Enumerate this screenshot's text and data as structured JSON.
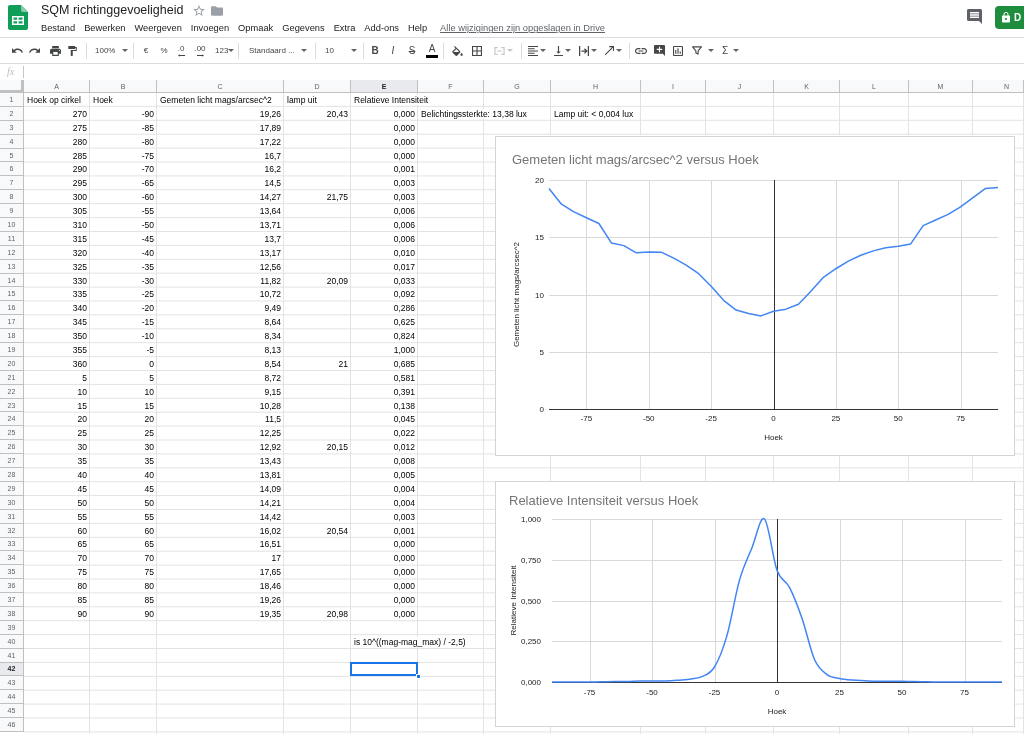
{
  "document": {
    "title": "SQM richtinggevoeligheid",
    "starred": false
  },
  "menu": [
    "Bestand",
    "Bewerken",
    "Weergeven",
    "Invoegen",
    "Opmaak",
    "Gegevens",
    "Extra",
    "Add-ons",
    "Help"
  ],
  "save_status": "Alle wijzigingen zijn opgeslagen in Drive",
  "share_button": "D",
  "toolbar": {
    "zoom": "100%",
    "currency": "€",
    "percent": "%",
    "decimals_less": ".0",
    "decimals_more": ".00",
    "number_format": "123",
    "font": "Standaard ...",
    "font_size": "10",
    "bold": "B",
    "italic": "I",
    "strikethrough": "S",
    "text_color": "A",
    "merge_disabled": true,
    "functions": "Σ"
  },
  "formula_bar": {
    "label": "fx"
  },
  "sheet": {
    "columns": [
      {
        "label": "A",
        "selected": false
      },
      {
        "label": "B",
        "selected": false
      },
      {
        "label": "C",
        "selected": false
      },
      {
        "label": "D",
        "selected": false
      },
      {
        "label": "E",
        "selected": true
      },
      {
        "label": "F",
        "selected": false
      },
      {
        "label": "G",
        "selected": false
      },
      {
        "label": "H",
        "selected": false
      },
      {
        "label": "I",
        "selected": false
      },
      {
        "label": "J",
        "selected": false
      },
      {
        "label": "K",
        "selected": false
      },
      {
        "label": "L",
        "selected": false
      },
      {
        "label": "M",
        "selected": false
      },
      {
        "label": "N",
        "selected": false
      }
    ],
    "rows": [
      {
        "number": "1",
        "selected": false,
        "cells": [
          {
            "text": "Hoek op cirkel",
            "kind": "text"
          },
          {
            "text": "Hoek",
            "kind": "text"
          },
          {
            "text": "Gemeten licht mags/arcsec^2",
            "kind": "text"
          },
          {
            "text": "lamp uit",
            "kind": "text"
          },
          {
            "text": "Relatieve Intensiteit",
            "kind": "text"
          }
        ]
      },
      {
        "number": "2",
        "selected": false,
        "cells": [
          {
            "text": "270",
            "kind": "number"
          },
          {
            "text": "-90",
            "kind": "number"
          },
          {
            "text": "19,26",
            "kind": "number"
          },
          {
            "text": "20,43",
            "kind": "number"
          },
          {
            "text": "0,000",
            "kind": "number"
          },
          {
            "text": "Belichtingssterkte: 13,38 lux",
            "kind": "text"
          },
          null,
          {
            "text": "Lamp uit: < 0,004 lux",
            "kind": "text"
          }
        ]
      },
      {
        "number": "3",
        "selected": false,
        "cells": [
          {
            "text": "275",
            "kind": "number"
          },
          {
            "text": "-85",
            "kind": "number"
          },
          {
            "text": "17,89",
            "kind": "number"
          },
          null,
          {
            "text": "0,000",
            "kind": "number"
          }
        ]
      },
      {
        "number": "4",
        "selected": false,
        "cells": [
          {
            "text": "280",
            "kind": "number"
          },
          {
            "text": "-80",
            "kind": "number"
          },
          {
            "text": "17,22",
            "kind": "number"
          },
          null,
          {
            "text": "0,000",
            "kind": "number"
          }
        ]
      },
      {
        "number": "5",
        "selected": false,
        "cells": [
          {
            "text": "285",
            "kind": "number"
          },
          {
            "text": "-75",
            "kind": "number"
          },
          {
            "text": "16,7",
            "kind": "number"
          },
          null,
          {
            "text": "0,000",
            "kind": "number"
          }
        ]
      },
      {
        "number": "6",
        "selected": false,
        "cells": [
          {
            "text": "290",
            "kind": "number"
          },
          {
            "text": "-70",
            "kind": "number"
          },
          {
            "text": "16,2",
            "kind": "number"
          },
          null,
          {
            "text": "0,001",
            "kind": "number"
          }
        ]
      },
      {
        "number": "7",
        "selected": false,
        "cells": [
          {
            "text": "295",
            "kind": "number"
          },
          {
            "text": "-65",
            "kind": "number"
          },
          {
            "text": "14,5",
            "kind": "number"
          },
          null,
          {
            "text": "0,003",
            "kind": "number"
          }
        ]
      },
      {
        "number": "8",
        "selected": false,
        "cells": [
          {
            "text": "300",
            "kind": "number"
          },
          {
            "text": "-60",
            "kind": "number"
          },
          {
            "text": "14,27",
            "kind": "number"
          },
          {
            "text": "21,75",
            "kind": "number"
          },
          {
            "text": "0,003",
            "kind": "number"
          }
        ]
      },
      {
        "number": "9",
        "selected": false,
        "cells": [
          {
            "text": "305",
            "kind": "number"
          },
          {
            "text": "-55",
            "kind": "number"
          },
          {
            "text": "13,64",
            "kind": "number"
          },
          null,
          {
            "text": "0,006",
            "kind": "number"
          }
        ]
      },
      {
        "number": "10",
        "selected": false,
        "cells": [
          {
            "text": "310",
            "kind": "number"
          },
          {
            "text": "-50",
            "kind": "number"
          },
          {
            "text": "13,71",
            "kind": "number"
          },
          null,
          {
            "text": "0,006",
            "kind": "number"
          }
        ]
      },
      {
        "number": "11",
        "selected": false,
        "cells": [
          {
            "text": "315",
            "kind": "number"
          },
          {
            "text": "-45",
            "kind": "number"
          },
          {
            "text": "13,7",
            "kind": "number"
          },
          null,
          {
            "text": "0,006",
            "kind": "number"
          }
        ]
      },
      {
        "number": "12",
        "selected": false,
        "cells": [
          {
            "text": "320",
            "kind": "number"
          },
          {
            "text": "-40",
            "kind": "number"
          },
          {
            "text": "13,17",
            "kind": "number"
          },
          null,
          {
            "text": "0,010",
            "kind": "number"
          }
        ]
      },
      {
        "number": "13",
        "selected": false,
        "cells": [
          {
            "text": "325",
            "kind": "number"
          },
          {
            "text": "-35",
            "kind": "number"
          },
          {
            "text": "12,56",
            "kind": "number"
          },
          null,
          {
            "text": "0,017",
            "kind": "number"
          }
        ]
      },
      {
        "number": "14",
        "selected": false,
        "cells": [
          {
            "text": "330",
            "kind": "number"
          },
          {
            "text": "-30",
            "kind": "number"
          },
          {
            "text": "11,82",
            "kind": "number"
          },
          {
            "text": "20,09",
            "kind": "number"
          },
          {
            "text": "0,033",
            "kind": "number"
          }
        ]
      },
      {
        "number": "15",
        "selected": false,
        "cells": [
          {
            "text": "335",
            "kind": "number"
          },
          {
            "text": "-25",
            "kind": "number"
          },
          {
            "text": "10,72",
            "kind": "number"
          },
          null,
          {
            "text": "0,092",
            "kind": "number"
          }
        ]
      },
      {
        "number": "16",
        "selected": false,
        "cells": [
          {
            "text": "340",
            "kind": "number"
          },
          {
            "text": "-20",
            "kind": "number"
          },
          {
            "text": "9,49",
            "kind": "number"
          },
          null,
          {
            "text": "0,286",
            "kind": "number"
          }
        ]
      },
      {
        "number": "17",
        "selected": false,
        "cells": [
          {
            "text": "345",
            "kind": "number"
          },
          {
            "text": "-15",
            "kind": "number"
          },
          {
            "text": "8,64",
            "kind": "number"
          },
          null,
          {
            "text": "0,625",
            "kind": "number"
          }
        ]
      },
      {
        "number": "18",
        "selected": false,
        "cells": [
          {
            "text": "350",
            "kind": "number"
          },
          {
            "text": "-10",
            "kind": "number"
          },
          {
            "text": "8,34",
            "kind": "number"
          },
          null,
          {
            "text": "0,824",
            "kind": "number"
          }
        ]
      },
      {
        "number": "19",
        "selected": false,
        "cells": [
          {
            "text": "355",
            "kind": "number"
          },
          {
            "text": "-5",
            "kind": "number"
          },
          {
            "text": "8,13",
            "kind": "number"
          },
          null,
          {
            "text": "1,000",
            "kind": "number"
          }
        ]
      },
      {
        "number": "20",
        "selected": false,
        "cells": [
          {
            "text": "360",
            "kind": "number"
          },
          {
            "text": "0",
            "kind": "number"
          },
          {
            "text": "8,54",
            "kind": "number"
          },
          {
            "text": "21",
            "kind": "number"
          },
          {
            "text": "0,685",
            "kind": "number"
          }
        ]
      },
      {
        "number": "21",
        "selected": false,
        "cells": [
          {
            "text": "5",
            "kind": "number"
          },
          {
            "text": "5",
            "kind": "number"
          },
          {
            "text": "8,72",
            "kind": "number"
          },
          null,
          {
            "text": "0,581",
            "kind": "number"
          }
        ]
      },
      {
        "number": "22",
        "selected": false,
        "cells": [
          {
            "text": "10",
            "kind": "number"
          },
          {
            "text": "10",
            "kind": "number"
          },
          {
            "text": "9,15",
            "kind": "number"
          },
          null,
          {
            "text": "0,391",
            "kind": "number"
          }
        ]
      },
      {
        "number": "23",
        "selected": false,
        "cells": [
          {
            "text": "15",
            "kind": "number"
          },
          {
            "text": "15",
            "kind": "number"
          },
          {
            "text": "10,28",
            "kind": "number"
          },
          null,
          {
            "text": "0,138",
            "kind": "number"
          }
        ]
      },
      {
        "number": "24",
        "selected": false,
        "cells": [
          {
            "text": "20",
            "kind": "number"
          },
          {
            "text": "20",
            "kind": "number"
          },
          {
            "text": "11,5",
            "kind": "number"
          },
          null,
          {
            "text": "0,045",
            "kind": "number"
          }
        ]
      },
      {
        "number": "25",
        "selected": false,
        "cells": [
          {
            "text": "25",
            "kind": "number"
          },
          {
            "text": "25",
            "kind": "number"
          },
          {
            "text": "12,25",
            "kind": "number"
          },
          null,
          {
            "text": "0,022",
            "kind": "number"
          }
        ]
      },
      {
        "number": "26",
        "selected": false,
        "cells": [
          {
            "text": "30",
            "kind": "number"
          },
          {
            "text": "30",
            "kind": "number"
          },
          {
            "text": "12,92",
            "kind": "number"
          },
          {
            "text": "20,15",
            "kind": "number"
          },
          {
            "text": "0,012",
            "kind": "number"
          }
        ]
      },
      {
        "number": "27",
        "selected": false,
        "cells": [
          {
            "text": "35",
            "kind": "number"
          },
          {
            "text": "35",
            "kind": "number"
          },
          {
            "text": "13,43",
            "kind": "number"
          },
          null,
          {
            "text": "0,008",
            "kind": "number"
          }
        ]
      },
      {
        "number": "28",
        "selected": false,
        "cells": [
          {
            "text": "40",
            "kind": "number"
          },
          {
            "text": "40",
            "kind": "number"
          },
          {
            "text": "13,81",
            "kind": "number"
          },
          null,
          {
            "text": "0,005",
            "kind": "number"
          }
        ]
      },
      {
        "number": "29",
        "selected": false,
        "cells": [
          {
            "text": "45",
            "kind": "number"
          },
          {
            "text": "45",
            "kind": "number"
          },
          {
            "text": "14,09",
            "kind": "number"
          },
          null,
          {
            "text": "0,004",
            "kind": "number"
          }
        ]
      },
      {
        "number": "30",
        "selected": false,
        "cells": [
          {
            "text": "50",
            "kind": "number"
          },
          {
            "text": "50",
            "kind": "number"
          },
          {
            "text": "14,21",
            "kind": "number"
          },
          null,
          {
            "text": "0,004",
            "kind": "number"
          }
        ]
      },
      {
        "number": "31",
        "selected": false,
        "cells": [
          {
            "text": "55",
            "kind": "number"
          },
          {
            "text": "55",
            "kind": "number"
          },
          {
            "text": "14,42",
            "kind": "number"
          },
          null,
          {
            "text": "0,003",
            "kind": "number"
          }
        ]
      },
      {
        "number": "32",
        "selected": false,
        "cells": [
          {
            "text": "60",
            "kind": "number"
          },
          {
            "text": "60",
            "kind": "number"
          },
          {
            "text": "16,02",
            "kind": "number"
          },
          {
            "text": "20,54",
            "kind": "number"
          },
          {
            "text": "0,001",
            "kind": "number"
          }
        ]
      },
      {
        "number": "33",
        "selected": false,
        "cells": [
          {
            "text": "65",
            "kind": "number"
          },
          {
            "text": "65",
            "kind": "number"
          },
          {
            "text": "16,51",
            "kind": "number"
          },
          null,
          {
            "text": "0,000",
            "kind": "number"
          }
        ]
      },
      {
        "number": "34",
        "selected": false,
        "cells": [
          {
            "text": "70",
            "kind": "number"
          },
          {
            "text": "70",
            "kind": "number"
          },
          {
            "text": "17",
            "kind": "number"
          },
          null,
          {
            "text": "0,000",
            "kind": "number"
          }
        ]
      },
      {
        "number": "35",
        "selected": false,
        "cells": [
          {
            "text": "75",
            "kind": "number"
          },
          {
            "text": "75",
            "kind": "number"
          },
          {
            "text": "17,65",
            "kind": "number"
          },
          null,
          {
            "text": "0,000",
            "kind": "number"
          }
        ]
      },
      {
        "number": "36",
        "selected": false,
        "cells": [
          {
            "text": "80",
            "kind": "number"
          },
          {
            "text": "80",
            "kind": "number"
          },
          {
            "text": "18,46",
            "kind": "number"
          },
          null,
          {
            "text": "0,000",
            "kind": "number"
          }
        ]
      },
      {
        "number": "37",
        "selected": false,
        "cells": [
          {
            "text": "85",
            "kind": "number"
          },
          {
            "text": "85",
            "kind": "number"
          },
          {
            "text": "19,26",
            "kind": "number"
          },
          null,
          {
            "text": "0,000",
            "kind": "number"
          }
        ]
      },
      {
        "number": "38",
        "selected": false,
        "cells": [
          {
            "text": "90",
            "kind": "number"
          },
          {
            "text": "90",
            "kind": "number"
          },
          {
            "text": "19,35",
            "kind": "number"
          },
          {
            "text": "20,98",
            "kind": "number"
          },
          {
            "text": "0,000",
            "kind": "number"
          }
        ]
      },
      {
        "number": "39",
        "selected": false
      },
      {
        "number": "40",
        "selected": false,
        "cells": [
          null,
          null,
          null,
          null,
          {
            "text": "is 10^((mag-mag_max) / -2,5)",
            "kind": "text"
          }
        ]
      },
      {
        "number": "41",
        "selected": false
      },
      {
        "number": "42",
        "selected": true
      },
      {
        "number": "43",
        "selected": false
      },
      {
        "number": "44",
        "selected": false
      },
      {
        "number": "45",
        "selected": false
      },
      {
        "number": "46",
        "selected": false
      }
    ]
  },
  "charts": [
    {
      "smooth": false,
      "chart_data": {
        "type": "line",
        "title": "Gemeten licht mags/arcsec^2 versus Hoek",
        "xlabel": "Hoek",
        "ylabel": "Gemeten licht mags/arcsec^2",
        "x": [
          -90,
          -85,
          -80,
          -75,
          -70,
          -65,
          -60,
          -55,
          -50,
          -45,
          -40,
          -35,
          -30,
          -25,
          -20,
          -15,
          -10,
          -5,
          0,
          5,
          10,
          15,
          20,
          25,
          30,
          35,
          40,
          45,
          50,
          55,
          60,
          65,
          70,
          75,
          80,
          85,
          90
        ],
        "series": [
          {
            "color": "#4285f4",
            "values": [
              19.26,
              17.89,
              17.22,
              16.7,
              16.2,
              14.5,
              14.27,
              13.64,
              13.71,
              13.7,
              13.17,
              12.56,
              11.82,
              10.72,
              9.49,
              8.64,
              8.34,
              8.13,
              8.54,
              8.72,
              9.15,
              10.28,
              11.5,
              12.25,
              12.92,
              13.43,
              13.81,
              14.09,
              14.21,
              14.42,
              16.02,
              16.51,
              17,
              17.65,
              18.46,
              19.26,
              19.35
            ]
          }
        ],
        "xlim": [
          -90,
          90
        ],
        "ylim": [
          0,
          20
        ],
        "xticks": [
          -75,
          -50,
          -25,
          0,
          25,
          50,
          75
        ],
        "yticks": [
          0,
          5,
          10,
          15,
          20
        ],
        "grid": true
      }
    },
    {
      "smooth": true,
      "chart_data": {
        "type": "line",
        "title": "Relatieve Intensiteit versus Hoek",
        "xlabel": "Hoek",
        "ylabel": "Relatieve Intensiteit",
        "x": [
          -90,
          -85,
          -80,
          -75,
          -70,
          -65,
          -60,
          -55,
          -50,
          -45,
          -40,
          -35,
          -30,
          -25,
          -20,
          -15,
          -10,
          -5,
          0,
          5,
          10,
          15,
          20,
          25,
          30,
          35,
          40,
          45,
          50,
          55,
          60,
          65,
          70,
          75,
          80,
          85,
          90
        ],
        "series": [
          {
            "color": "#4285f4",
            "values": [
              0,
              0,
              0,
              0,
              0.001,
              0.003,
              0.003,
              0.006,
              0.006,
              0.006,
              0.01,
              0.017,
              0.033,
              0.092,
              0.286,
              0.625,
              0.824,
              1,
              0.685,
              0.581,
              0.391,
              0.138,
              0.045,
              0.022,
              0.012,
              0.008,
              0.005,
              0.004,
              0.004,
              0.003,
              0.001,
              0,
              0,
              0,
              0,
              0,
              0
            ]
          }
        ],
        "xlim": [
          -90,
          90
        ],
        "ylim": [
          0,
          1
        ],
        "xticks": [
          -75,
          -50,
          -25,
          0,
          25,
          50,
          75
        ],
        "yticks": [
          {
            "value": 0,
            "label": "0,000"
          },
          {
            "value": 0.25,
            "label": "0,250"
          },
          {
            "value": 0.5,
            "label": "0,500"
          },
          {
            "value": 0.75,
            "label": "0,750"
          },
          {
            "value": 1,
            "label": "1,000"
          }
        ],
        "grid": true
      }
    }
  ]
}
